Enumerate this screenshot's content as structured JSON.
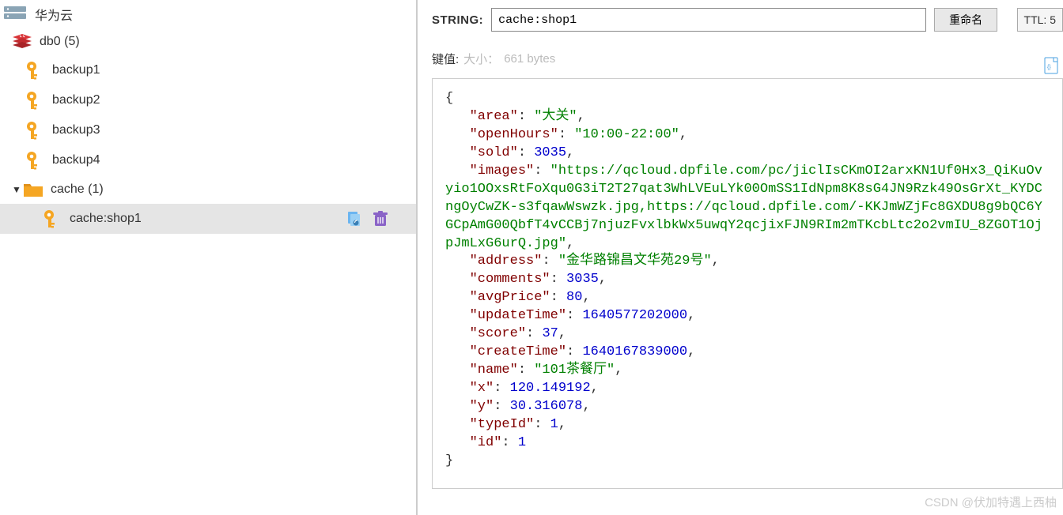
{
  "sidebar": {
    "server": {
      "name": "华为云"
    },
    "db": {
      "label": "db0",
      "count": "(5)"
    },
    "keys": [
      {
        "name": "backup1"
      },
      {
        "name": "backup2"
      },
      {
        "name": "backup3"
      },
      {
        "name": "backup4"
      }
    ],
    "folder": {
      "name": "cache",
      "count": "(1)"
    },
    "selected_key": {
      "name": "cache:shop1"
    }
  },
  "header": {
    "type_label": "STRING:",
    "key_name": "cache:shop1",
    "rename_btn": "重命名",
    "ttl_label": "TTL:",
    "ttl_value": "5"
  },
  "meta": {
    "label": "键值:",
    "size_label": "大小：",
    "size_value": "661 bytes"
  },
  "value": {
    "area_k": "\"area\"",
    "area_v": "\"大关\"",
    "openHours_k": "\"openHours\"",
    "openHours_v": "\"10:00-22:00\"",
    "sold_k": "\"sold\"",
    "sold_v": "3035",
    "images_k": "\"images\"",
    "images_v": "\"https://qcloud.dpfile.com/pc/jiclIsCKmOI2arxKN1Uf0Hx3_QiKuOvyio1OOxsRtFoXqu0G3iT2T27qat3WhLVEuLYk00OmSS1IdNpm8K8sG4JN9Rzk49OsGrXt_KYDCngOyCwZK-s3fqawWswzk.jpg,https://qcloud.dpfile.com/-KKJmWZjFc8GXDU8g9bQC6YGCpAmG00QbfT4vCCBj7njuzFvxlbkWx5uwqY2qcjixFJN9RIm2mTKcbLtc2o2vmIU_8ZGOT1OjpJmLxG6urQ.jpg\"",
    "address_k": "\"address\"",
    "address_v": "\"金华路锦昌文华苑29号\"",
    "comments_k": "\"comments\"",
    "comments_v": "3035",
    "avgPrice_k": "\"avgPrice\"",
    "avgPrice_v": "80",
    "updateTime_k": "\"updateTime\"",
    "updateTime_v": "1640577202000",
    "score_k": "\"score\"",
    "score_v": "37",
    "createTime_k": "\"createTime\"",
    "createTime_v": "1640167839000",
    "name_k": "\"name\"",
    "name_v": "\"101茶餐厅\"",
    "x_k": "\"x\"",
    "x_v": "120.149192",
    "y_k": "\"y\"",
    "y_v": "30.316078",
    "typeId_k": "\"typeId\"",
    "typeId_v": "1",
    "id_k": "\"id\"",
    "id_v": "1"
  },
  "watermark": "CSDN @伏加特遇上西柚"
}
